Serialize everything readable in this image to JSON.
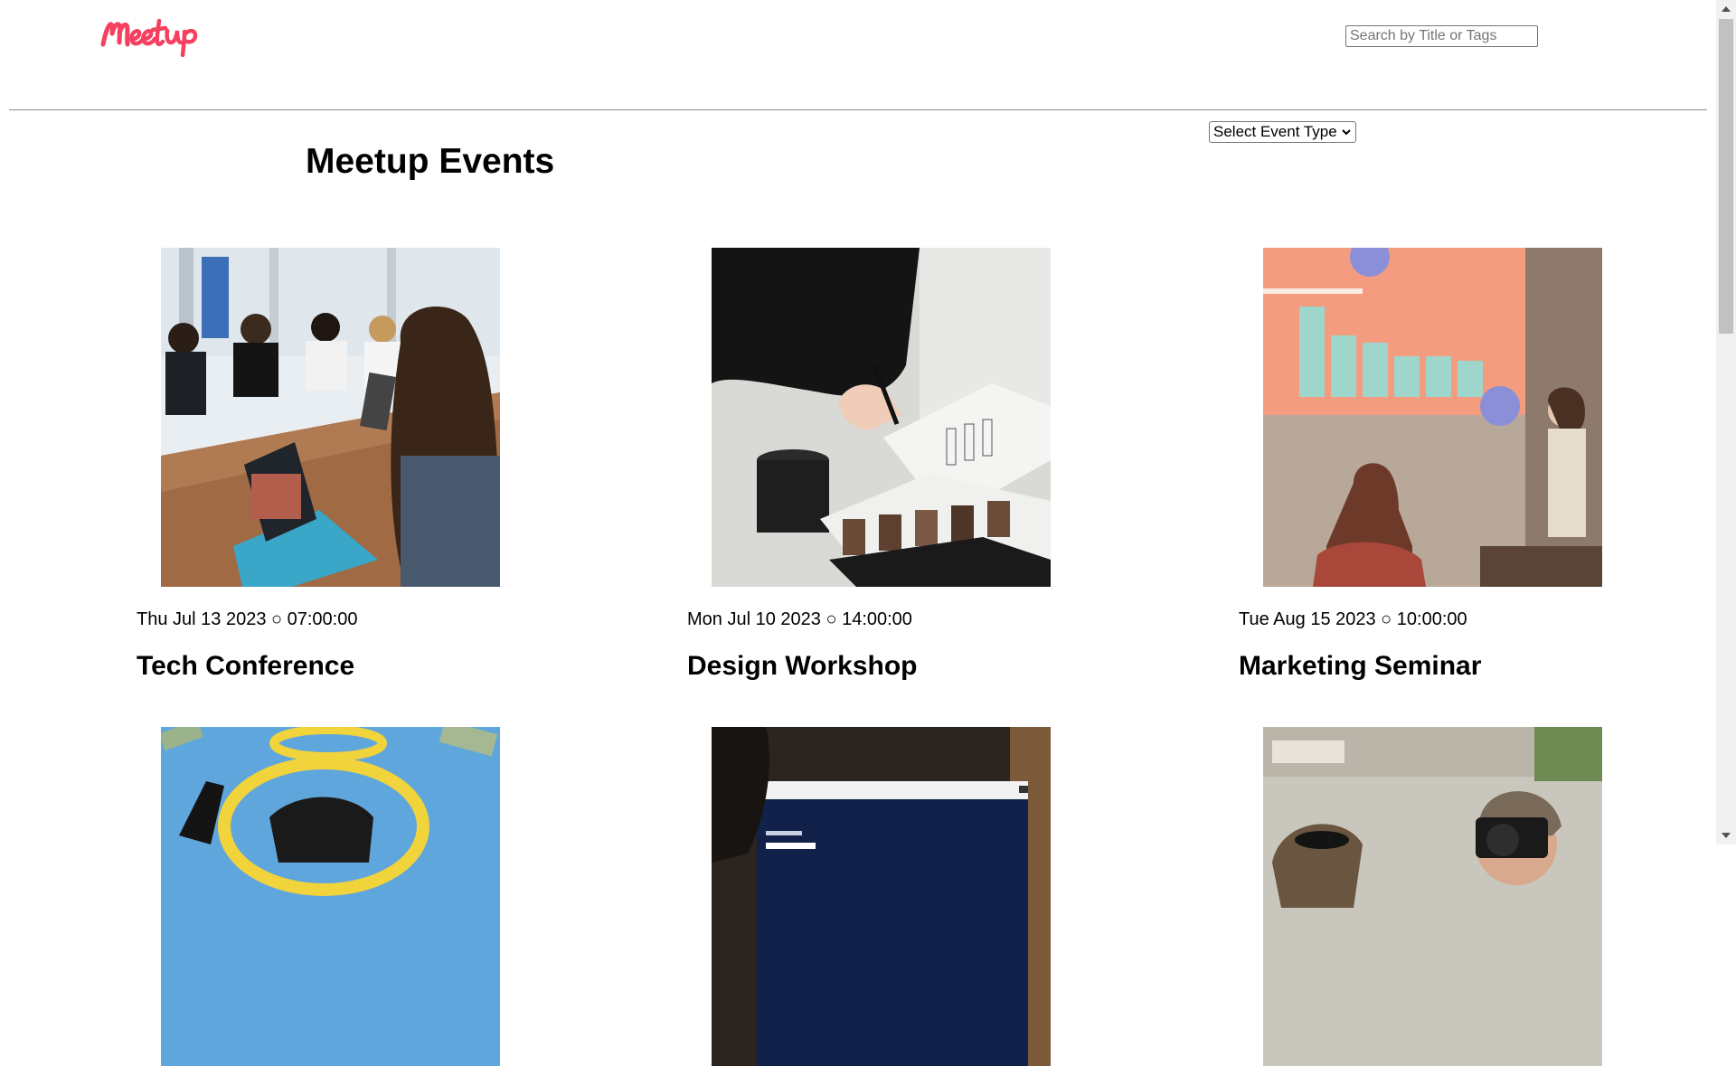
{
  "brand": {
    "logo_text": "Meetup",
    "logo_color": "#f64060"
  },
  "search": {
    "placeholder": "Search by Title or Tags"
  },
  "page": {
    "title": "Meetup Events"
  },
  "filter": {
    "selected": "Select Event Type"
  },
  "events": [
    {
      "date": "Thu Jul 13 2023 ○ 07:00:00",
      "title": "Tech Conference",
      "image": "office-meeting-photo"
    },
    {
      "date": "Mon Jul 10 2023 ○ 14:00:00",
      "title": "Design Workshop",
      "image": "sketching-notebook-photo"
    },
    {
      "date": "Tue Aug 15 2023 ○ 10:00:00",
      "title": "Marketing Seminar",
      "image": "presentation-chart-photo"
    },
    {
      "date": "",
      "title": "",
      "image": "money-halo-illustration"
    },
    {
      "date": "",
      "title": "",
      "image": "data-science-screen-photo"
    },
    {
      "date": "",
      "title": "",
      "image": "photographer-street-photo"
    }
  ]
}
